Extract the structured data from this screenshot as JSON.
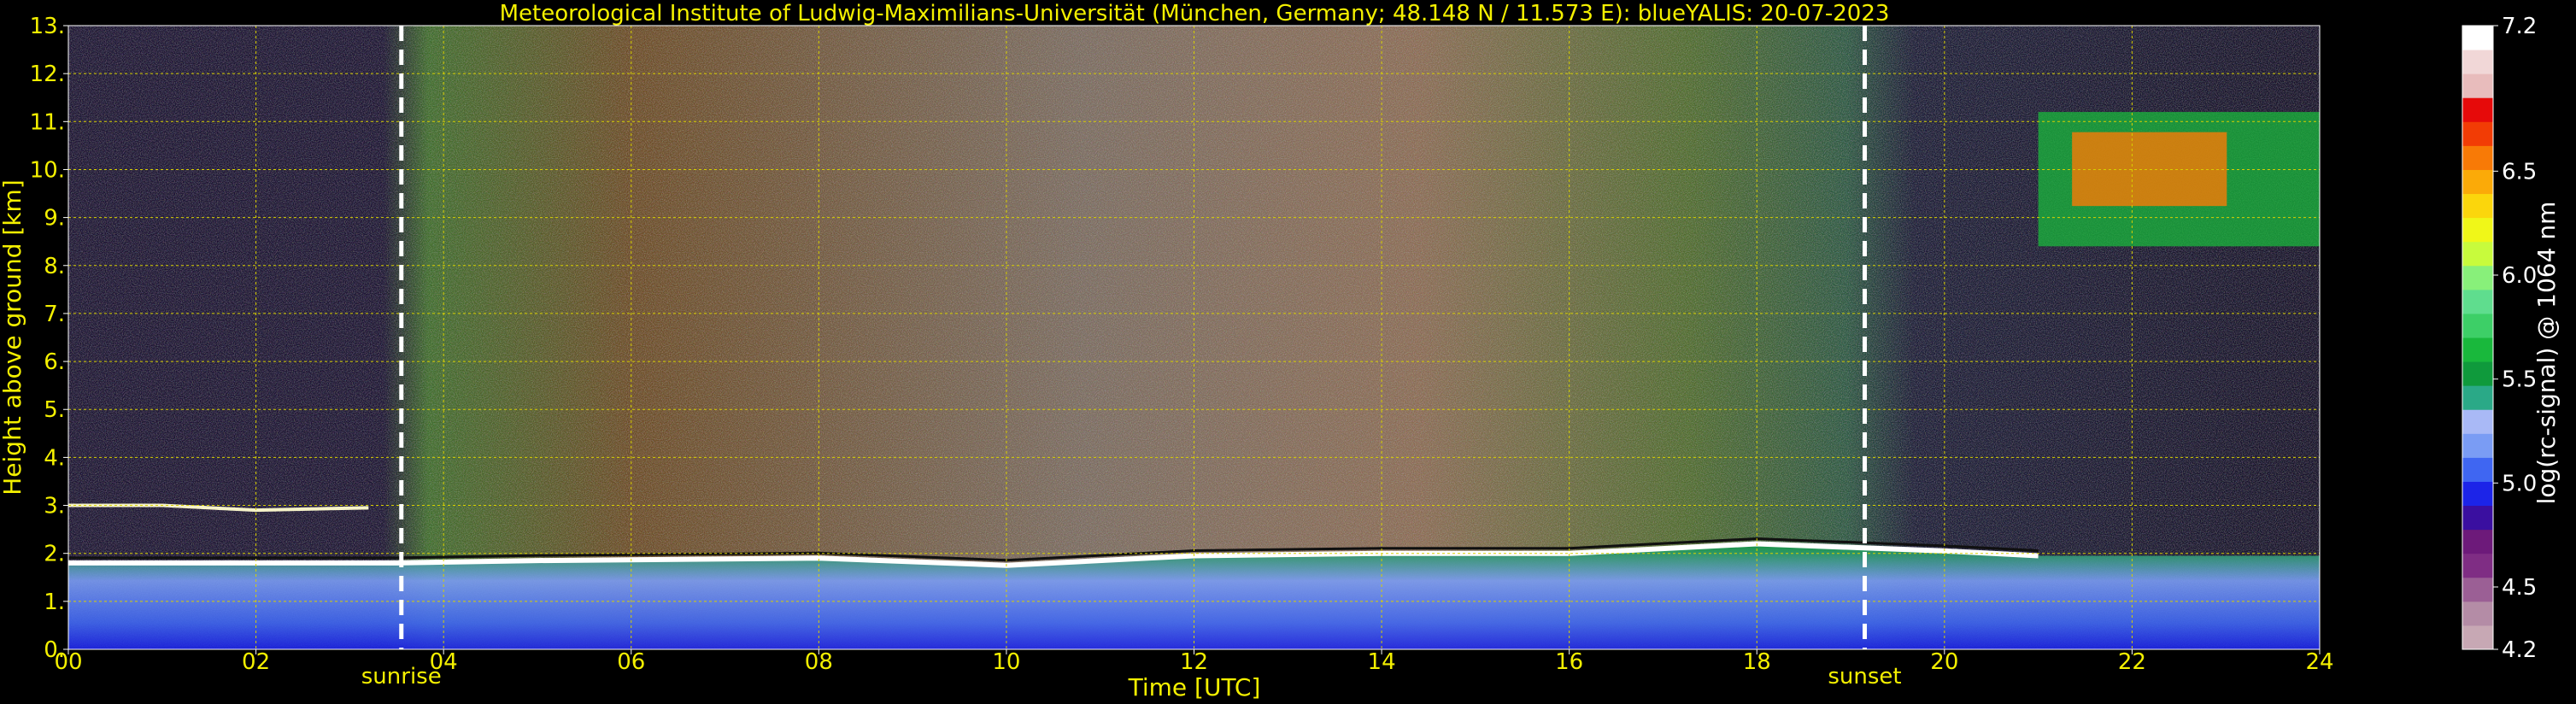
{
  "chart_data": {
    "type": "heatmap",
    "title": "Meteorological Institute of Ludwig-Maximilians-Universität (München, Germany; 48.148 N / 11.573 E):    blueYALIS: 20-07-2023",
    "xlabel": "Time [UTC]",
    "ylabel": "Height above ground [km]",
    "xlim": [
      0,
      24
    ],
    "ylim": [
      0,
      13
    ],
    "x_ticks": [
      "00",
      "02",
      "04",
      "06",
      "08",
      "10",
      "12",
      "14",
      "16",
      "18",
      "20",
      "22",
      "24"
    ],
    "y_ticks": [
      "0.",
      "1.",
      "2.",
      "3.",
      "4.",
      "5.",
      "6.",
      "7.",
      "8.",
      "9.",
      "10.",
      "11.",
      "12.",
      "13."
    ],
    "grid": true,
    "colorbar": {
      "label": "log(rc-signal) @ 1064 nm",
      "range": [
        4.2,
        7.2
      ],
      "ticks": [
        "4.2",
        "4.5",
        "5.0",
        "5.5",
        "6.0",
        "6.5",
        "7.2"
      ],
      "colors": [
        "#c7a8b4",
        "#b48ca6",
        "#9b5f95",
        "#7f2d84",
        "#6d1a7a",
        "#3a0fa0",
        "#1c24e8",
        "#3f66f2",
        "#7a9cf4",
        "#a9b9f6",
        "#2aa987",
        "#0f9a3c",
        "#19b83c",
        "#3dcf67",
        "#5fdd8e",
        "#88f07a",
        "#c8fb3c",
        "#f0f718",
        "#fbd60c",
        "#fbaa08",
        "#f87a06",
        "#f23c05",
        "#e60a0a",
        "#e8bcbc",
        "#f1d7d7",
        "#ffffff"
      ]
    },
    "markers": [
      {
        "label": "sunrise",
        "x": 3.55
      },
      {
        "label": "sunset",
        "x": 19.15
      }
    ],
    "features": [
      {
        "name": "boundary-layer-top",
        "x": [
          0,
          3.5,
          5,
          8,
          10,
          12,
          14,
          16,
          18,
          20,
          21
        ],
        "y": [
          1.8,
          1.8,
          1.85,
          1.9,
          1.75,
          1.95,
          2.0,
          2.0,
          2.2,
          2.05,
          1.95
        ]
      },
      {
        "name": "residual-layer-top",
        "x": [
          0,
          1,
          2,
          3.2
        ],
        "y": [
          3.0,
          3.0,
          2.9,
          2.95
        ]
      },
      {
        "name": "cirrus-cloud",
        "x_range": [
          21.0,
          24
        ],
        "y_range": [
          8.4,
          11.2
        ]
      }
    ],
    "colors": {
      "text": "#f4f000",
      "background": "#000000",
      "grid": "#d8d000",
      "marker": "#ffffff"
    }
  }
}
